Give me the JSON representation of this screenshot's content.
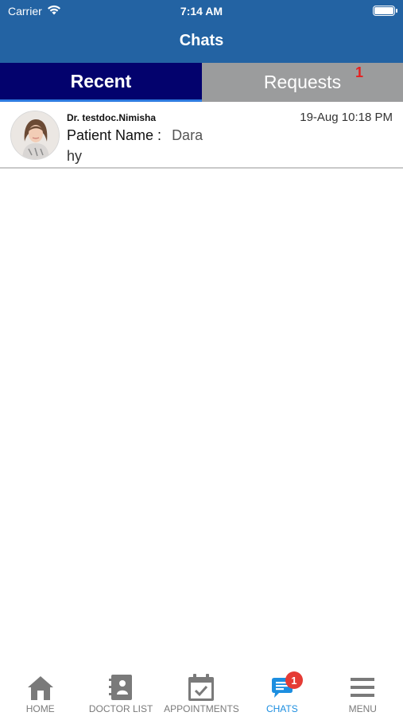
{
  "status_bar": {
    "carrier": "Carrier",
    "time": "7:14 AM"
  },
  "header": {
    "title": "Chats"
  },
  "tabs": [
    {
      "label": "Recent",
      "active": true
    },
    {
      "label": "Requests",
      "badge": "1",
      "active": false
    }
  ],
  "chats": [
    {
      "doctor": "Dr. testdoc.Nimisha",
      "timestamp": "19-Aug 10:18 PM",
      "patient_label": "Patient Name :",
      "patient_name": "Dara",
      "message": "hy"
    }
  ],
  "tabbar": {
    "items": [
      {
        "label": "HOME",
        "icon": "home-icon"
      },
      {
        "label": "DOCTOR LIST",
        "icon": "contacts-book-icon"
      },
      {
        "label": "APPOINTMENTS",
        "icon": "calendar-check-icon"
      },
      {
        "label": "CHATS",
        "icon": "chat-bubble-icon",
        "badge": "1",
        "active": true
      },
      {
        "label": "MENU",
        "icon": "hamburger-menu-icon"
      }
    ]
  },
  "colors": {
    "header": "#2363a3",
    "tab_active": "#03026d",
    "tab_inactive": "#9b9c9d",
    "accent": "#1c8ee0",
    "badge": "#e53b35",
    "icon_gray": "#7a7a7a"
  }
}
